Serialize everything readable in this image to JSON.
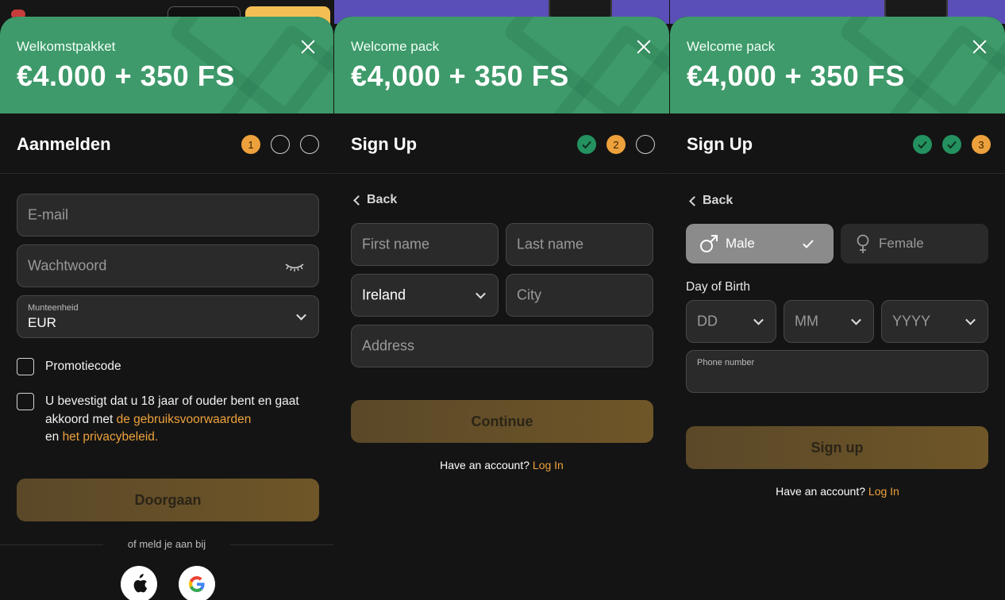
{
  "panel1": {
    "banner_sub": "Welkomstpakket",
    "banner_title": "€4.000 + 350 FS",
    "form_title": "Aanmelden",
    "step_active": "1",
    "email_placeholder": "E-mail",
    "password_placeholder": "Wachtwoord",
    "currency_label": "Munteenheid",
    "currency_value": "EUR",
    "promo_label": "Promotiecode",
    "terms_text_1": "U bevestigt dat u 18 jaar of ouder bent en gaat akkoord met",
    "terms_link_1": "de gebruiksvoorwaarden",
    "terms_text_2": "en",
    "terms_link_2": "het privacybeleid.",
    "continue_label": "Doorgaan",
    "or_text": "of meld je aan bij",
    "social_icons": [
      "apple-icon",
      "google-icon"
    ]
  },
  "panel2": {
    "banner_sub": "Welcome pack",
    "banner_title": "€4,000 + 350 FS",
    "form_title": "Sign Up",
    "step_active": "2",
    "back_label": "Back",
    "first_name_placeholder": "First name",
    "last_name_placeholder": "Last name",
    "country_value": "Ireland",
    "city_placeholder": "City",
    "address_placeholder": "Address",
    "continue_label": "Continue",
    "have_account": "Have an account?",
    "login_label": "Log In"
  },
  "panel3": {
    "banner_sub": "Welcome pack",
    "banner_title": "€4,000 + 350 FS",
    "form_title": "Sign Up",
    "step_active": "3",
    "back_label": "Back",
    "male_label": "Male",
    "female_label": "Female",
    "dob_label": "Day of Birth",
    "dd_placeholder": "DD",
    "mm_placeholder": "MM",
    "yyyy_placeholder": "YYYY",
    "phone_label": "Phone number",
    "signup_label": "Sign up",
    "have_account": "Have an account?",
    "login_label": "Log In"
  },
  "colors": {
    "banner_green": "#3e9a6a",
    "accent_orange": "#eda13c",
    "step_done_green": "#239160",
    "button_gold": "#6f5628"
  }
}
